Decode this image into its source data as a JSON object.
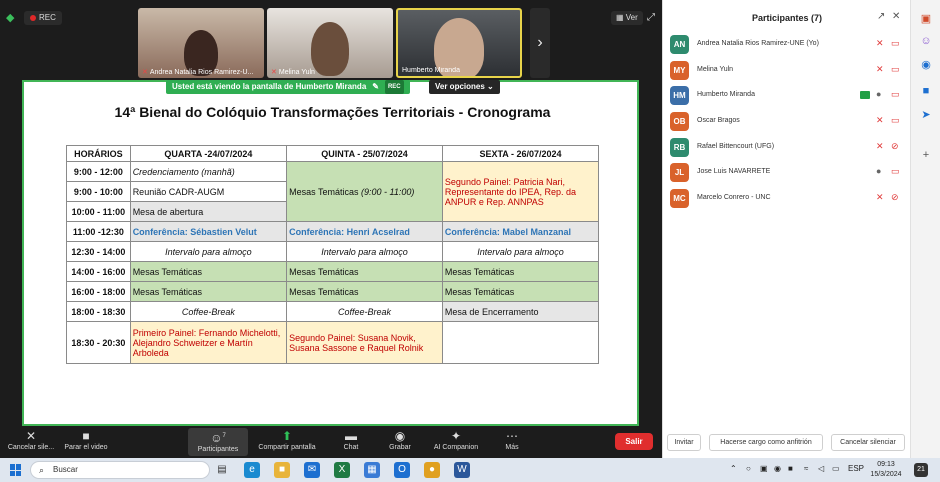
{
  "meeting": {
    "rec_label": "REC",
    "view_label": "Ver",
    "thumbnails": [
      {
        "name": "Andrea Natalia Rios Ramirez-U..."
      },
      {
        "name": "Melina Yuln"
      },
      {
        "name": "Humberto Miranda"
      }
    ],
    "share_notice": "Usted está viendo la pantalla de Humberto Miranda",
    "share_rec": "REC",
    "options_label": "Ver opciones"
  },
  "slide": {
    "title": "14ª Bienal do Colóquio Transformações Territoriais - Cronograma",
    "headers": [
      "HORÁRIOS",
      "QUARTA -24/07/2024",
      "QUINTA - 25/07/2024",
      "SEXTA - 26/07/2024"
    ],
    "rows": {
      "r1": {
        "time": "9:00 - 12:00",
        "qua": "Credenciamento (manhã)"
      },
      "r2": {
        "time": "9:00 - 10:00",
        "qua": "Reunião CADR-AUGM"
      },
      "r3": {
        "time": "10:00 - 11:00",
        "qua": "Mesa de abertura"
      },
      "qui_block": "Mesas Temáticas ",
      "qui_block_time": "(9:00 - 11:00)",
      "sex_block": "Segundo Painel: Patricia Nari, Representante do IPEA, Rep. da ANPUR e Rep. ANNPAS",
      "r4": {
        "time": "11:00 -12:30",
        "qua": "Conferência: Sébastien Velut",
        "qui": "Conferência: Henri Acselrad",
        "sex": "Conferência: Mabel Manzanal"
      },
      "r5": {
        "time": "12:30 - 14:00",
        "qua": "Intervalo para almoço",
        "qui": "Intervalo para almoço",
        "sex": "Intervalo para almoço"
      },
      "r6": {
        "time": "14:00 - 16:00",
        "qua": "Mesas Temáticas",
        "qui": "Mesas Temáticas",
        "sex": "Mesas Temáticas"
      },
      "r7": {
        "time": "16:00 - 18:00",
        "qua": "Mesas Temáticas",
        "qui": "Mesas Temáticas",
        "sex": "Mesas Temáticas"
      },
      "r8": {
        "time": "18:00 - 18:30",
        "qua": "Coffee-Break",
        "qui": "Coffee-Break",
        "sex": "Mesa de Encerramento"
      },
      "r9": {
        "time": "18:30 - 20:30",
        "qua": "Primeiro Painel: Fernando Michelotti, Alejandro Schweitzer e Martín Arboleda",
        "qui": "Segundo Painel: Susana Novik, Susana Sassone e Raquel Rolnik",
        "sex": ""
      }
    }
  },
  "toolbar": {
    "mute": "Cancelar sile...",
    "video": "Parar el video",
    "participants": "Participantes",
    "participants_count": "7",
    "share": "Compartir pantalla",
    "chat": "Chat",
    "record": "Grabar",
    "ai": "AI Companion",
    "more": "Más",
    "leave": "Salir"
  },
  "panel": {
    "title": "Participantes (7)",
    "participants": [
      {
        "initials": "AN",
        "name": "Andrea Natalia Rios Ramirez-UNE (Yo)",
        "color": "#2e8b6e"
      },
      {
        "initials": "MY",
        "name": "Melina Yuln",
        "color": "#d9622b"
      },
      {
        "initials": "HM",
        "name": "Humberto Miranda",
        "color": "#3b6ea8"
      },
      {
        "initials": "OB",
        "name": "Oscar Bragos",
        "color": "#d9622b"
      },
      {
        "initials": "RB",
        "name": "Rafael Bittencourt (UFG)",
        "color": "#2e8b6e"
      },
      {
        "initials": "JL",
        "name": "Jose Luis NAVARRETE",
        "color": "#d9622b"
      },
      {
        "initials": "MC",
        "name": "Marcelo Conrero - UNC",
        "color": "#d9622b"
      }
    ],
    "invite": "Invitar",
    "host": "Hacerse cargo como anfitrión",
    "mute_all": "Cancelar silenciar"
  },
  "taskbar": {
    "search": "Buscar",
    "lang": "ESP",
    "time": "09:13",
    "date": "15/3/2024",
    "notif": "21"
  }
}
